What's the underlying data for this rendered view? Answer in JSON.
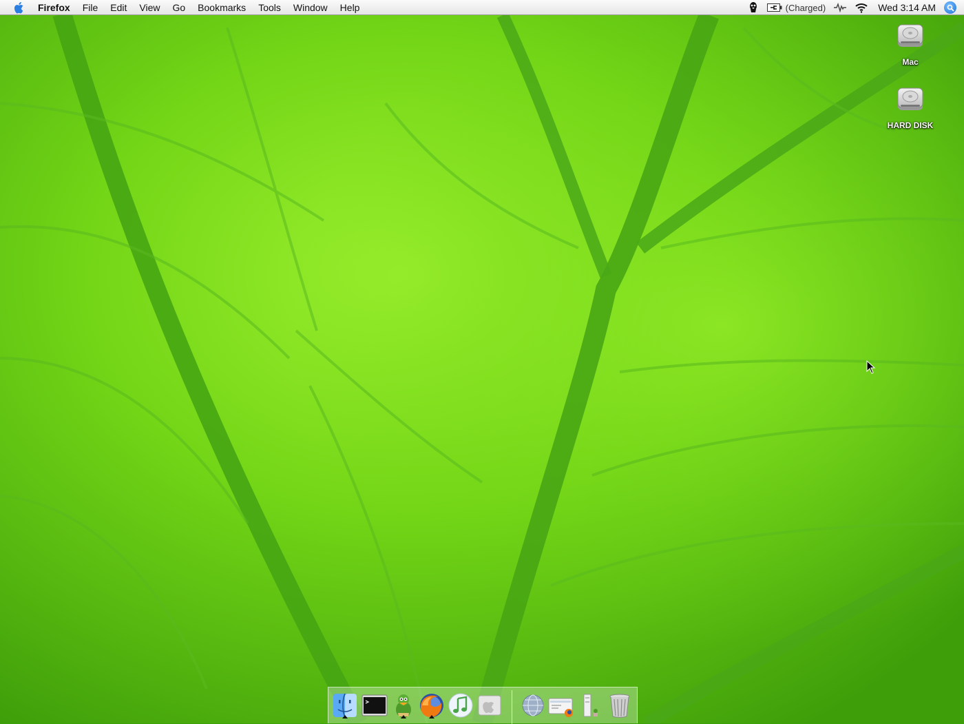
{
  "menubar": {
    "app_name": "Firefox",
    "menus": [
      "File",
      "Edit",
      "View",
      "Go",
      "Bookmarks",
      "Tools",
      "Window",
      "Help"
    ],
    "battery_status": "(Charged)",
    "clock": "Wed 3:14 AM"
  },
  "desktop": {
    "icons": [
      {
        "label": "Mac",
        "icon": "hard-drive-icon"
      },
      {
        "label": "HARD DISK",
        "icon": "hard-drive-icon"
      }
    ]
  },
  "dock": {
    "apps": [
      {
        "name": "Finder",
        "icon": "finder-icon",
        "running": true
      },
      {
        "name": "Terminal",
        "icon": "terminal-icon",
        "running": false
      },
      {
        "name": "Adium",
        "icon": "adium-duck-icon",
        "running": true
      },
      {
        "name": "Firefox",
        "icon": "firefox-icon",
        "running": true
      },
      {
        "name": "iTunes",
        "icon": "itunes-icon",
        "running": false
      },
      {
        "name": "Boot Camp",
        "icon": "apple-logo-icon",
        "running": false
      }
    ],
    "others": [
      {
        "name": "Network",
        "icon": "globe-icon"
      },
      {
        "name": "Downloads",
        "icon": "downloads-folder-icon"
      },
      {
        "name": "Applications",
        "icon": "applications-stack-icon"
      },
      {
        "name": "Trash",
        "icon": "trash-icon"
      }
    ]
  },
  "colors": {
    "wallpaper_dark": "#3a9e0b",
    "wallpaper_light": "#8fe82a",
    "menubar": "#efefef",
    "spotlight": "#1a6fd8"
  }
}
